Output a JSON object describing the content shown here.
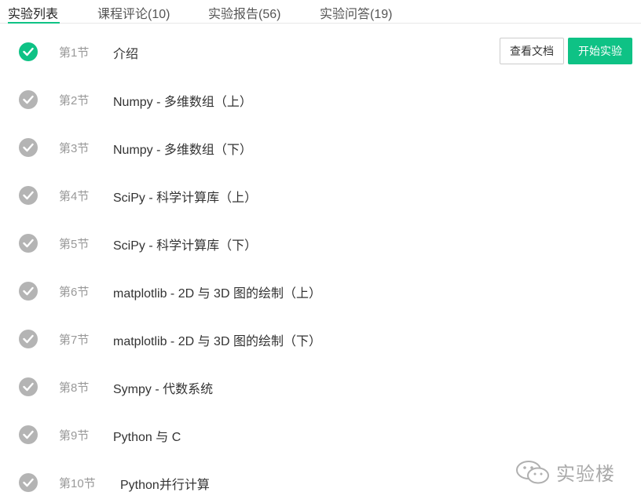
{
  "tabs": [
    {
      "label": "实验列表"
    },
    {
      "label": "课程评论(10)"
    },
    {
      "label": "实验报告(56)"
    },
    {
      "label": "实验问答(19)"
    }
  ],
  "rows": [
    {
      "num": "第1节",
      "title": "介绍"
    },
    {
      "num": "第2节",
      "title": "Numpy - 多维数组（上）"
    },
    {
      "num": "第3节",
      "title": "Numpy - 多维数组（下）"
    },
    {
      "num": "第4节",
      "title": "SciPy - 科学计算库（上）"
    },
    {
      "num": "第5节",
      "title": "SciPy - 科学计算库（下）"
    },
    {
      "num": "第6节",
      "title": "matplotlib - 2D 与 3D 图的绘制（上）"
    },
    {
      "num": "第7节",
      "title": "matplotlib - 2D 与 3D 图的绘制（下）"
    },
    {
      "num": "第8节",
      "title": "Sympy - 代数系统"
    },
    {
      "num": "第9节",
      "title": "Python 与 C"
    },
    {
      "num": "第10节",
      "title": "Python并行计算"
    }
  ],
  "actions": {
    "view_doc": "查看文档",
    "start": "开始实验"
  },
  "watermark": {
    "text": "实验楼",
    "icon": "wechat-icon"
  },
  "colors": {
    "accent": "#0ec285",
    "check_done": "#0ec285",
    "check_pending": "#b4b4b4"
  }
}
